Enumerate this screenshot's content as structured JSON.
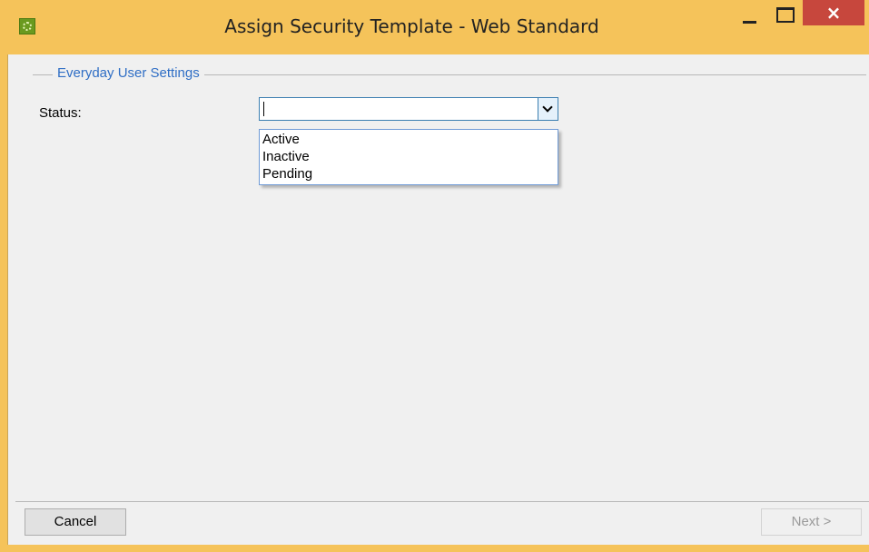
{
  "window": {
    "title": "Assign Security Template - Web Standard",
    "close_glyph": "×",
    "accent_color": "#f5c35a",
    "close_color": "#c7473d"
  },
  "group": {
    "title": "Everyday User Settings"
  },
  "form": {
    "status_label": "Status:",
    "status_value": ""
  },
  "dropdown": {
    "options": [
      "Active",
      "Inactive",
      "Pending"
    ]
  },
  "footer": {
    "cancel_label": "Cancel",
    "next_label": "Next >"
  },
  "icons": {
    "app": "app-logo-icon",
    "minimize": "minimize-icon",
    "maximize": "maximize-icon",
    "close": "close-icon",
    "dropdown": "chevron-down-icon"
  }
}
